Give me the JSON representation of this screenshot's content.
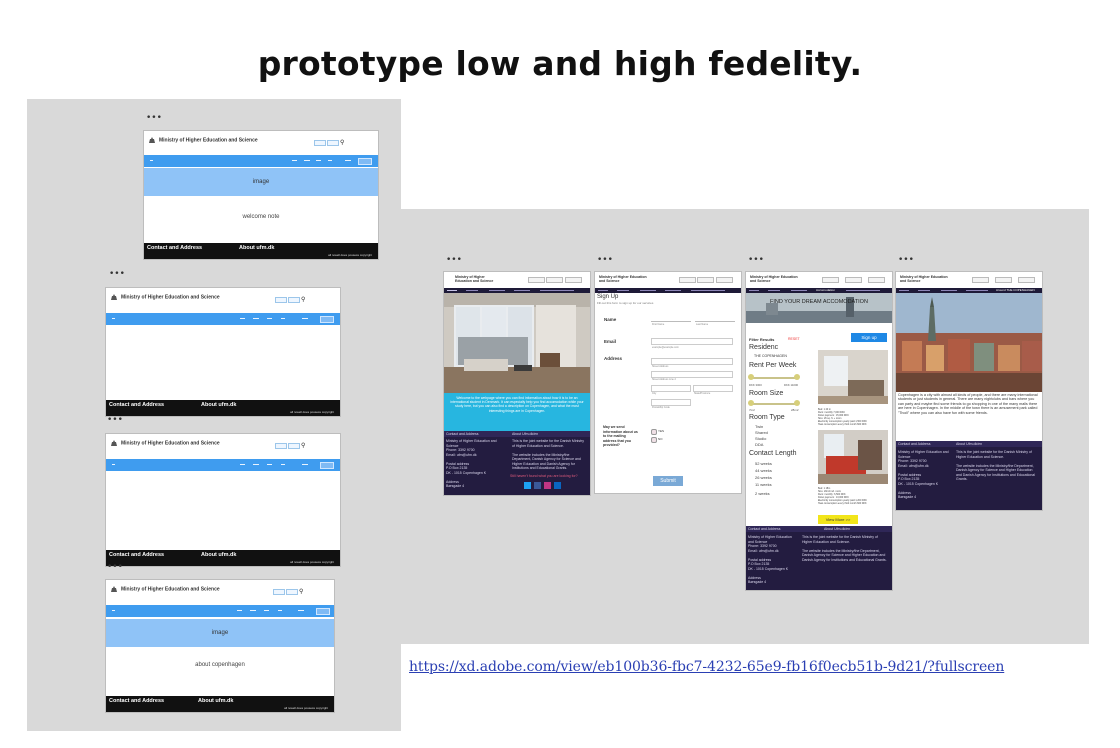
{
  "slide": {
    "title": "prototype low and high fedelity.",
    "link": "https://xd.adobe.com/view/eb100b36-fbc7-4232-65e9-fb16f0ecb51b-9d21/?fullscreen"
  },
  "artboard_menu": "•••",
  "low_fi": {
    "logo": "Ministry of Higher Education and Science",
    "image_label": "image",
    "welcome_note": "welcome note",
    "about_note": "about copenhagen",
    "footer_contact": "Contact and Address",
    "footer_about": "About ufm.dk",
    "footer_small": "all rewell does possess copyright"
  },
  "high_fi": {
    "logo": "Ministry of Higher Education and Science",
    "nav": [
      "Front Page",
      "Job Center",
      "Social Network",
      "Accomodation",
      "Around THE COPENHAGEN"
    ],
    "nav_active_accomodation": "Accomodation",
    "nav_active_around": "Around THE COPENHAGEN",
    "welcome_text": "Welcome to the webpage where you can find information about how it is to be an international student in Denmark. It can especially help you find accomodation while your study here, but you can also find a description on Copenhagen, and what the most interesting things are in Copenhagen.",
    "footer": {
      "contact_head": "Contact and Address",
      "about_head": "About Ufm.dk/en",
      "contact_body": "Ministry of Higher Education and Science\nPhone: 3392 9700\nEmail: ufm@ufm.dk\n\nPostal address\nP.O Box 2135\nDK - 1015 Copenhagen K\n\nAddress\nBørsgade 4",
      "about_body": "This is the joint website for the Danish Ministry of Higher Education and Science.\n\nThe website includes the Ministry/the Department, Danish Agency for Science and Higher Education and Danish Agency for Institutions and Educational Grants.",
      "social_prompt": "Still haven't found what you are looking for?"
    },
    "signup": {
      "title": "Sign Up",
      "subtitle": "Fill out this form to sign up for our services",
      "name_label": "Name",
      "first_name": "First Name",
      "last_name": "Last Name",
      "email_label": "Email",
      "email_hint": "example@example.com",
      "address_label": "Address",
      "street": "Street Address",
      "street2": "Street Address Line 2",
      "city": "City",
      "state": "State/Province",
      "postal": "Postal/Zip Code",
      "question": "May we send information about us to the mailing address that you provided?",
      "yes": "YES",
      "no": "NO",
      "submit": "Submit"
    },
    "accommodation": {
      "hero": "FIND YOUR DREAM ACCOMODATION",
      "sign_up": "Sign up",
      "filter_results": "Filter Results",
      "reset": "RESET",
      "residence_head": "Residenc",
      "residence_value": "THE COPENHAGEN",
      "rent_head": "Rent Per Week",
      "rent_min": "DKK 3000",
      "rent_max": "DKK 11000",
      "room_size_head": "Room Size",
      "size_min": "7m2",
      "size_max": "28m2",
      "room_type_head": "Room Type",
      "room_types": [
        "Twin",
        "Shared",
        "Studio",
        "DDA"
      ],
      "contract_head": "Contact Length",
      "contract_lengths": [
        "52 weeks",
        "44 weeks",
        "26 weeks",
        "11 weeks",
        "2 weeks"
      ],
      "listing1": "Bed: 1 20 m\nRent: monthly 7,000 DKK\nDown payment : 15,000 DKK\nSize: 26 sq. ft. + room\nElectricity consumption yearly paid 1,500 DKK\nHeat consumption every third month 600 DKK",
      "listing2": "Bed: 1 18m\nSize: 20m2 incl. room\nRent: monthly: 6,500 DKK\nDown payment : 13,000 DKK\nElectricity consumption yearly paid 1,200 DKK\nHeat consumption every third month 600 DKK",
      "view_more": "View More >>"
    },
    "copenhagen": {
      "text": "Copenhagen is a city with almost all kinds of people, and there are many international students or just students in general. There are many nightclubs and bars where you can party and maybe find some friends to go shopping in one of the many malls there are here in Copenhagen. In the middle of the town there is an amusement park called \"Tivoli\" where you can also have fun with some friends."
    }
  },
  "colors": {
    "panel": "#d9d9d9",
    "lowfi_nav": "#3f9cef",
    "lowfi_image": "#8fc3f7",
    "footer_dark": "#231c40",
    "welcome_band": "#27b6e0",
    "submit": "#7aa9d6",
    "view_more": "#f2e51a",
    "link": "#2a3fb3"
  }
}
